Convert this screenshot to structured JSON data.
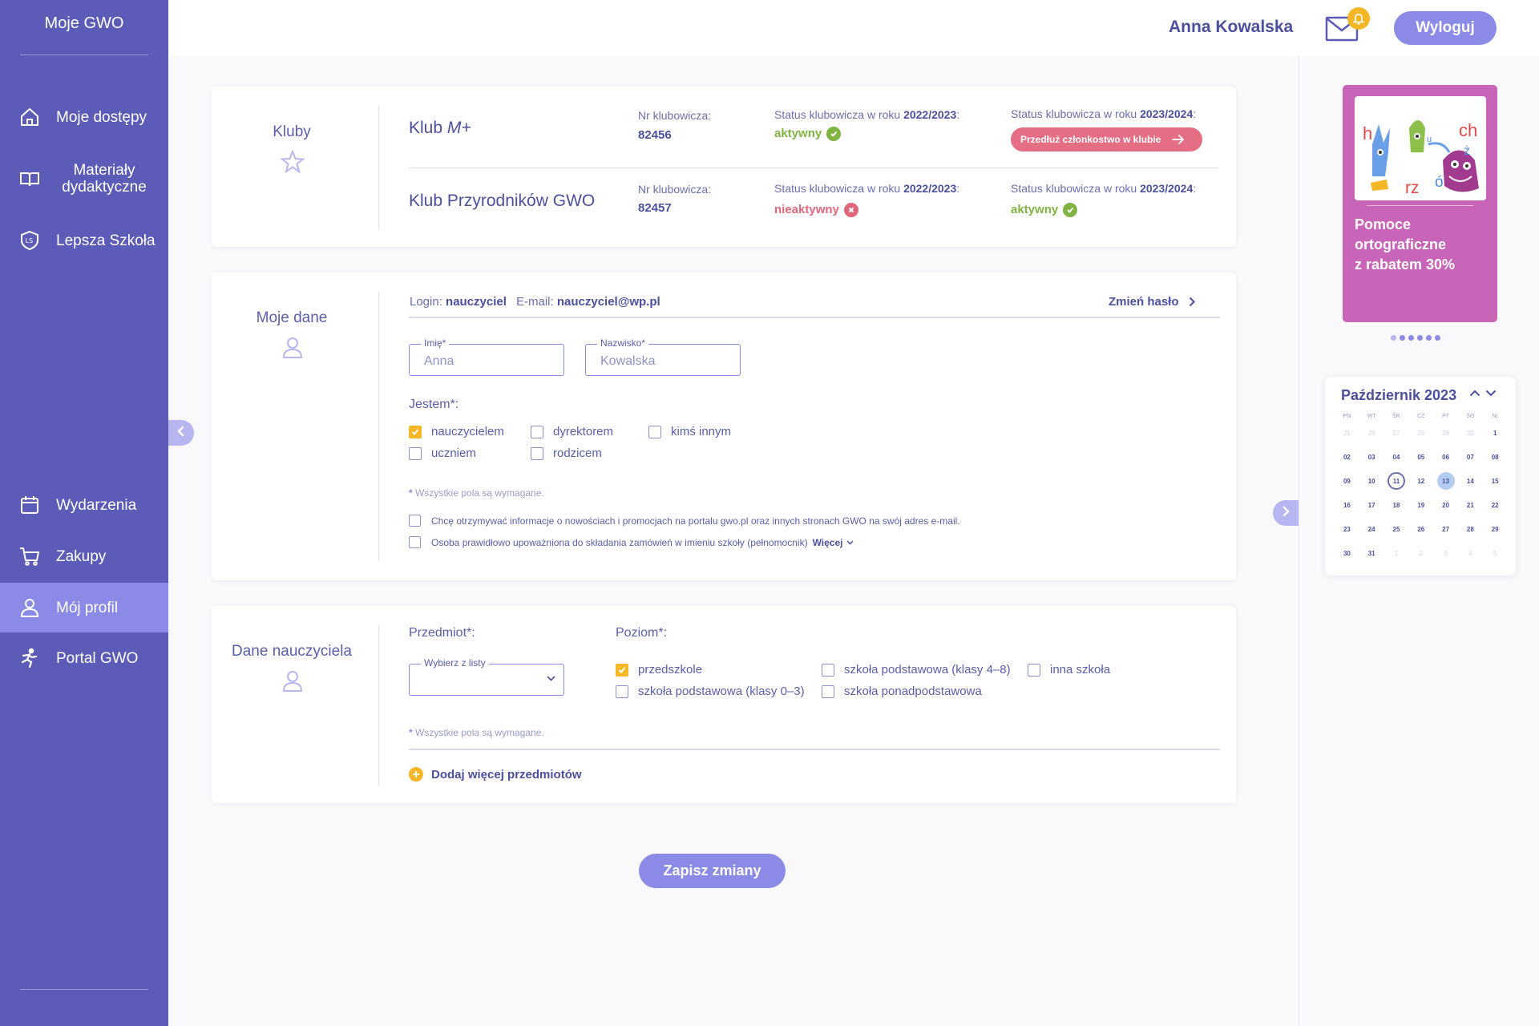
{
  "sidebar": {
    "brand": "Moje GWO",
    "top_items": [
      {
        "label": "Moje dostępy",
        "icon": "home-icon"
      },
      {
        "label": "Materiały dydaktyczne",
        "icon": "book-icon"
      },
      {
        "label": "Lepsza Szkoła",
        "icon": "shield-ls-icon"
      }
    ],
    "bottom_items": [
      {
        "label": "Wydarzenia",
        "icon": "calendar-icon"
      },
      {
        "label": "Zakupy",
        "icon": "cart-icon"
      },
      {
        "label": "Mój profil",
        "icon": "user-icon",
        "active": true
      },
      {
        "label": "Portal GWO",
        "icon": "runner-icon"
      }
    ]
  },
  "header": {
    "user_name": "Anna Kowalska",
    "logout_label": "Wyloguj"
  },
  "clubs": {
    "title": "Kluby",
    "rows": [
      {
        "name_prefix": "Klub ",
        "name_italic": "M+",
        "nr_label": "Nr klubowicza:",
        "nr_value": "82456",
        "status1_label": "Status klubowicza w roku ",
        "status1_year": "2022/2023",
        "status1_value": "aktywny",
        "status2_label": "Status klubowicza w roku ",
        "status2_year": "2023/2024",
        "status2_button": "Przedłuż członkostwo w klubie"
      },
      {
        "name": "Klub Przyrodników GWO",
        "nr_label": "Nr klubowicza:",
        "nr_value": "82457",
        "status1_label": "Status klubowicza w roku ",
        "status1_year": "2022/2023",
        "status1_value": "nieaktywny",
        "status2_label": "Status klubowicza w roku ",
        "status2_year": "2023/2024",
        "status2_value": "aktywny"
      }
    ]
  },
  "my_data": {
    "title": "Moje dane",
    "login_label": "Login: ",
    "login_value": "nauczyciel",
    "email_label": "E-mail: ",
    "email_value": "nauczyciel@wp.pl",
    "change_password": "Zmień hasło",
    "first_name_label": "Imię*",
    "first_name_value": "Anna",
    "last_name_label": "Nazwisko*",
    "last_name_value": "Kowalska",
    "role_label": "Jestem*:",
    "roles": [
      {
        "label": "nauczycielem",
        "checked": true
      },
      {
        "label": "dyrektorem",
        "checked": false
      },
      {
        "label": "kimś innym",
        "checked": false
      },
      {
        "label": "uczniem",
        "checked": false
      },
      {
        "label": "rodzicem",
        "checked": false
      }
    ],
    "required_star": "*",
    "required_note": " Wszystkie pola są wymagane.",
    "consent_newsletter": "Chcę otrzymywać informacje o nowościach i promocjach na portalu gwo.pl oraz innych stronach GWO na swój adres e-mail.",
    "consent_proxy": "Osoba prawidłowo upoważniona do składania zamówień w imieniu szkoły (pełnomocnik)",
    "more_label": "Więcej"
  },
  "teacher": {
    "title": "Dane nauczyciela",
    "subject_label": "Przedmiot*:",
    "subject_placeholder": "Wybierz z listy",
    "level_label": "Poziom*:",
    "levels": [
      {
        "label": "przedszkole",
        "checked": true
      },
      {
        "label": "szkoła podstawowa (klasy 4–8)",
        "checked": false
      },
      {
        "label": "inna szkoła",
        "checked": false
      },
      {
        "label": "szkoła podstawowa (klasy 0–3)",
        "checked": false
      },
      {
        "label": "szkoła ponadpodstawowa",
        "checked": false
      }
    ],
    "required_star": "*",
    "required_note": " Wszystkie pola są wymagane.",
    "add_more": "Dodaj więcej przedmiotów"
  },
  "save_label": "Zapisz zmiany",
  "promo": {
    "text_line1": "Pomoce",
    "text_line2": "ortograficzne",
    "text_line3": "z rabatem 30%",
    "letters": [
      "h",
      "ch",
      "u",
      "ż",
      "rz",
      "ó"
    ],
    "dots": 6,
    "active_dot": 0
  },
  "calendar": {
    "title": "Październik 2023",
    "weekdays": [
      "PN",
      "WT",
      "ŚR",
      "CZ",
      "PT",
      "SO",
      "NI"
    ],
    "weeks": [
      [
        "25",
        "26",
        "27",
        "28",
        "29",
        "30",
        "1"
      ],
      [
        "02",
        "03",
        "04",
        "05",
        "06",
        "07",
        "08"
      ],
      [
        "09",
        "10",
        "11",
        "12",
        "13",
        "14",
        "15"
      ],
      [
        "16",
        "17",
        "18",
        "19",
        "20",
        "21",
        "22"
      ],
      [
        "23",
        "24",
        "25",
        "26",
        "27",
        "28",
        "29"
      ],
      [
        "30",
        "31",
        "1",
        "2",
        "3",
        "4",
        "5"
      ]
    ],
    "today": "11",
    "selected": "13"
  },
  "colors": {
    "sidebar": "#5c5cb8",
    "accent": "#8b8ae6",
    "text": "#4b4f9e",
    "checkbox_checked": "#f6b727",
    "success": "#7fb342",
    "danger": "#e0667a",
    "promo": "#c965b8"
  }
}
